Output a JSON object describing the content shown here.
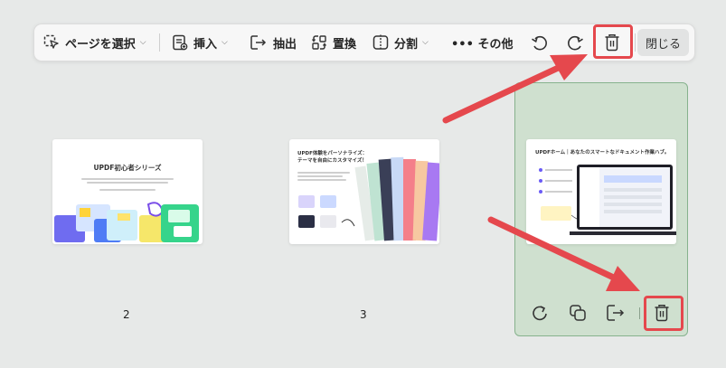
{
  "toolbar": {
    "select_pages_label": "ページを選択",
    "insert_label": "挿入",
    "extract_label": "抽出",
    "replace_label": "置換",
    "split_label": "分割",
    "more_label": "••• その他",
    "close_label": "閉じる"
  },
  "pages": [
    {
      "number": "2",
      "title": "UPDF初心者シリーズ"
    },
    {
      "number": "3",
      "title_line1": "UPDF体験をパーソナライズ：",
      "title_line2": "テーマを自由にカスタマイズ！"
    },
    {
      "title": "UPDFホーム｜あなたのスマートなドキュメント作業ハブ。"
    }
  ],
  "colors": {
    "highlight": "#e5484d",
    "selected_bg": "#cfe0cf",
    "selected_border": "#86b28d"
  }
}
